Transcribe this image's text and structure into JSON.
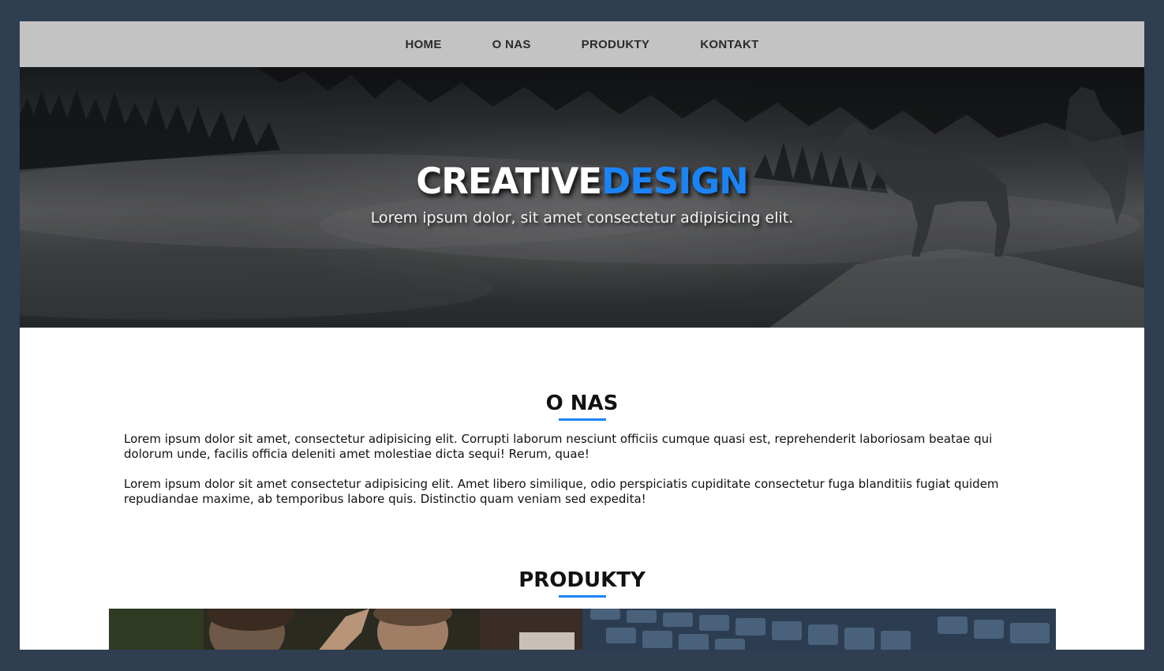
{
  "nav": {
    "items": [
      {
        "label": "HOME"
      },
      {
        "label": "O NAS"
      },
      {
        "label": "PRODUKTY"
      },
      {
        "label": "KONTAKT"
      }
    ]
  },
  "hero": {
    "title_part1": "CREATIVE",
    "title_part2": "DESIGN",
    "subtitle": "Lorem ipsum dolor, sit amet consectetur adipisicing elit."
  },
  "about": {
    "title": "O NAS",
    "paragraphs": [
      "Lorem ipsum dolor sit amet, consectetur adipisicing elit. Corrupti laborum nesciunt officiis cumque quasi est, reprehenderit laboriosam beatae qui dolorum unde, facilis officia deleniti amet molestiae dicta sequi! Rerum, quae!",
      "Lorem ipsum dolor sit amet consectetur adipisicing elit. Amet libero similique, odio perspiciatis cupiditate consectetur fuga blanditiis fugiat quidem repudiandae maxime, ab temporibus labore quis. Distinctio quam veniam sed expedita!"
    ]
  },
  "products": {
    "title": "PRODUKTY"
  },
  "colors": {
    "accent": "#1b84f5",
    "nav_bg": "#c4c3c4",
    "frame_bg": "#2f3e50"
  }
}
